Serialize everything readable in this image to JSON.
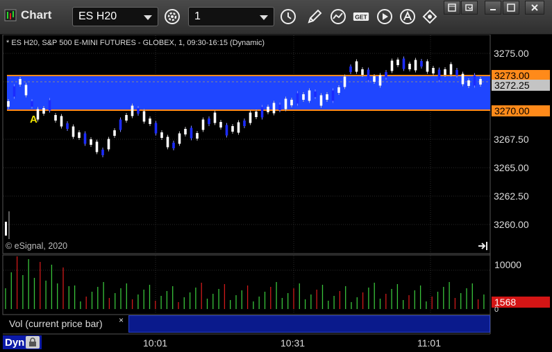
{
  "window": {
    "title": "Chart",
    "symbol": "ES H20",
    "interval": "1"
  },
  "toolbar": {
    "icons": [
      "gear-icon",
      "clock-icon",
      "pencil-icon",
      "study-icon",
      "get-icon",
      "play-icon",
      "alert-icon",
      "link-icon"
    ],
    "get_label": "GET"
  },
  "chart": {
    "description": "* ES H20, S&P 500 E-MINI FUTURES - GLOBEX, 1, 09:30-16:15 (Dynamic)",
    "watermark": "© eSignal, 2020",
    "marker": "A",
    "price_axis": [
      "3275.00",
      "3272.25",
      "3267.50",
      "3265.00",
      "3262.50",
      "3260.00"
    ],
    "price_tags": {
      "upper": "3273.00",
      "current": "3272.25",
      "lower": "3270.00"
    },
    "volume_axis": "10000",
    "volume_tag": "1568",
    "volume_zero": "0",
    "time_axis": [
      "10:01",
      "10:31",
      "11:01"
    ],
    "colors": {
      "band": "#1f46ff",
      "band_line": "#ff8a1a",
      "up_bar": "#ffffff",
      "down_bar": "#1b2bff",
      "vol_up": "#39c43b",
      "vol_down": "#d01a1a"
    }
  },
  "study": {
    "label": "Vol (current price bar)",
    "close": "×"
  },
  "status": {
    "mode": "Dyn"
  }
}
